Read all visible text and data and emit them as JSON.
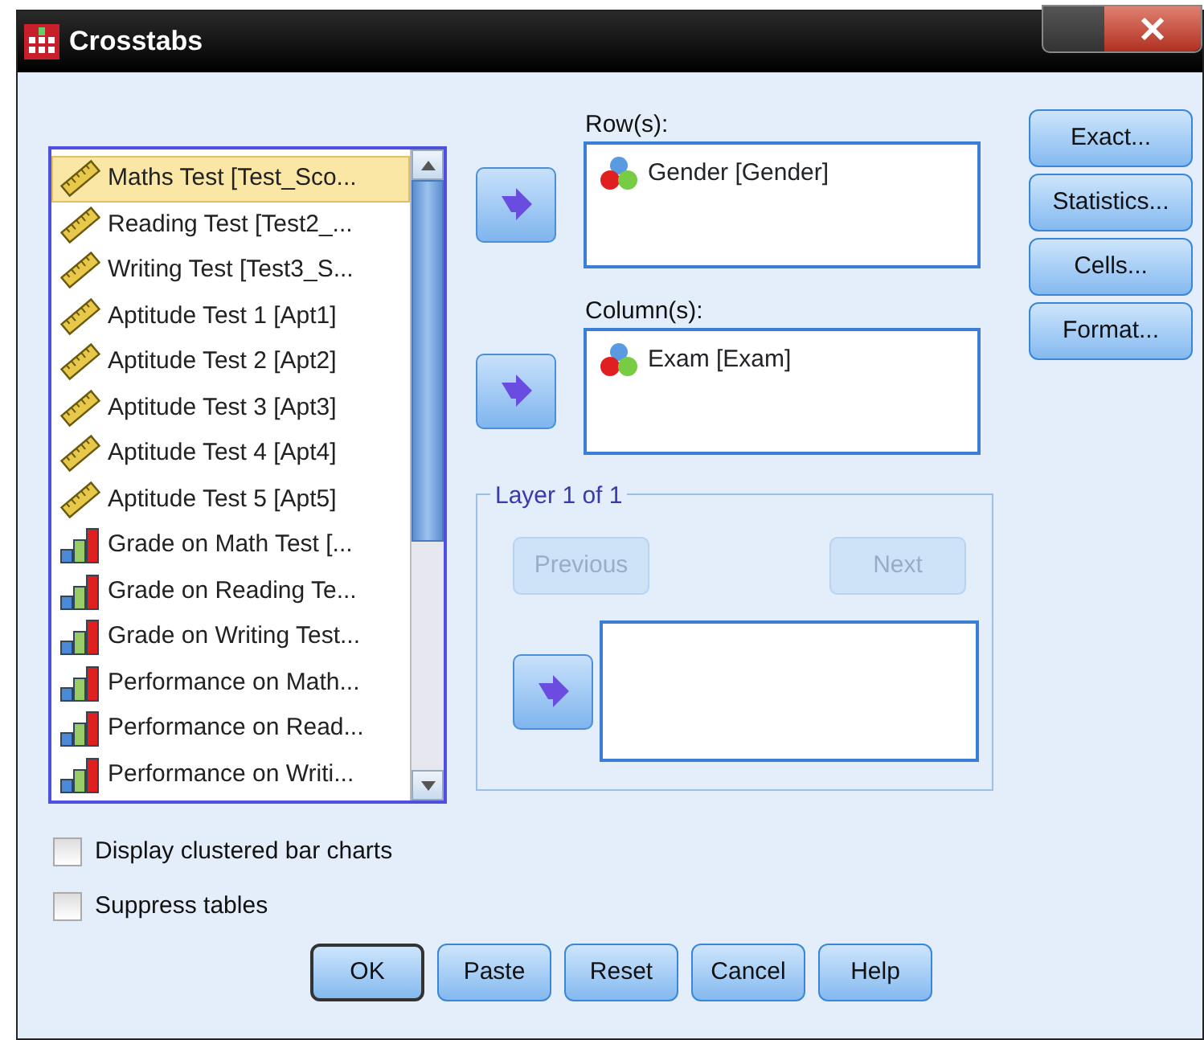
{
  "window": {
    "title": "Crosstabs"
  },
  "variables": [
    {
      "label": "Maths Test [Test_Sco...",
      "kind": "scale",
      "selected": true
    },
    {
      "label": "Reading Test [Test2_...",
      "kind": "scale",
      "selected": false
    },
    {
      "label": "Writing Test [Test3_S...",
      "kind": "scale",
      "selected": false
    },
    {
      "label": "Aptitude Test 1 [Apt1]",
      "kind": "scale",
      "selected": false
    },
    {
      "label": "Aptitude Test 2 [Apt2]",
      "kind": "scale",
      "selected": false
    },
    {
      "label": "Aptitude Test 3 [Apt3]",
      "kind": "scale",
      "selected": false
    },
    {
      "label": "Aptitude Test 4 [Apt4]",
      "kind": "scale",
      "selected": false
    },
    {
      "label": "Aptitude Test 5 [Apt5]",
      "kind": "scale",
      "selected": false
    },
    {
      "label": "Grade on Math Test [...",
      "kind": "ordinal",
      "selected": false
    },
    {
      "label": "Grade on Reading Te...",
      "kind": "ordinal",
      "selected": false
    },
    {
      "label": "Grade on Writing Test...",
      "kind": "ordinal",
      "selected": false
    },
    {
      "label": "Performance on Math...",
      "kind": "ordinal",
      "selected": false
    },
    {
      "label": "Performance on Read...",
      "kind": "ordinal",
      "selected": false
    },
    {
      "label": "Performance on Writi...",
      "kind": "ordinal",
      "selected": false
    }
  ],
  "rows": {
    "label": "Row(s):",
    "items": [
      {
        "label": "Gender [Gender]",
        "kind": "nominal"
      }
    ]
  },
  "columns": {
    "label": "Column(s):",
    "items": [
      {
        "label": "Exam [Exam]",
        "kind": "nominal"
      }
    ]
  },
  "layer": {
    "title": "Layer 1 of 1",
    "buttons": [
      {
        "label": "Previous",
        "disabled": true
      },
      {
        "label": "Next",
        "disabled": true
      }
    ]
  },
  "side_buttons": [
    "Exact...",
    "Statistics...",
    "Cells...",
    "Format..."
  ],
  "options": [
    {
      "label": "Display clustered bar charts",
      "checked": false
    },
    {
      "label": "Suppress tables",
      "checked": false
    }
  ],
  "buttons": [
    {
      "label": "OK",
      "default": true
    },
    {
      "label": "Paste",
      "default": false
    },
    {
      "label": "Reset",
      "default": false
    },
    {
      "label": "Cancel",
      "default": false
    },
    {
      "label": "Help",
      "default": false
    }
  ]
}
